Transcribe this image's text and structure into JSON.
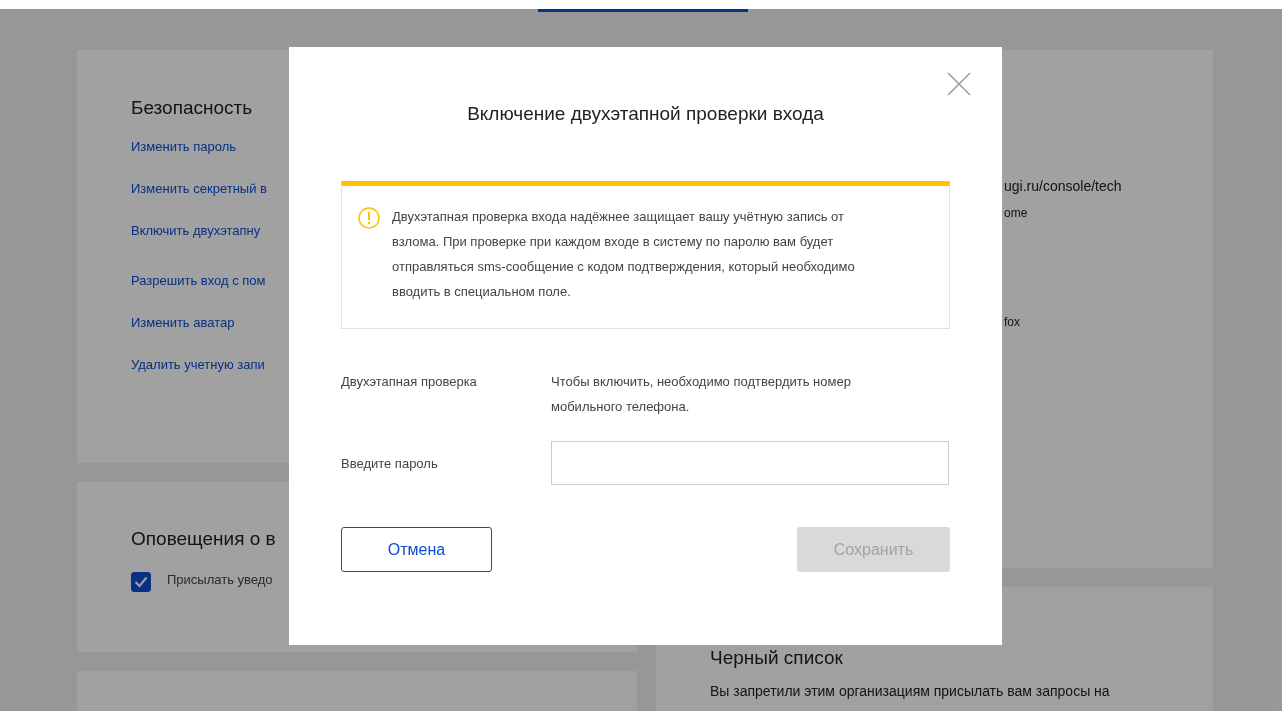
{
  "background": {
    "security": {
      "title": "Безопасность",
      "links": [
        "Изменить пароль",
        "Изменить секретный в",
        "Включить двухэтапну",
        "Разрешить вход с пом",
        "Изменить аватар",
        "Удалить учетную запи"
      ]
    },
    "notifications": {
      "title": "Оповещения о в",
      "options": [
        {
          "label": "Присылать уведо",
          "checked": true
        }
      ]
    },
    "sessions": {
      "lines": [
        {
          "kind": "big",
          "text": "ugi.ru/console/tech"
        },
        {
          "kind": "small",
          "text": "ome"
        },
        {
          "kind": "small",
          "text": "fox"
        }
      ]
    },
    "blacklist": {
      "title": "Черный список",
      "text": "Вы запретили этим организациям присылать вам запросы на"
    }
  },
  "modal": {
    "title": "Включение двухэтапной проверки входа",
    "notice": "Двухэтапная проверка входа надёжнее защищает вашу учётную запись от взлома. При проверке при каждом входе в систему по паролю вам будет отправляться sms-сообщение с кодом подтверждения, который необходимо вводить в специальном поле.",
    "rows": [
      {
        "kind": "text",
        "label": "Двухэтапная проверка",
        "value": "Чтобы включить, необходимо подтвердить номер мобильного телефона."
      },
      {
        "kind": "input",
        "label": "Введите пароль"
      }
    ],
    "buttons": [
      {
        "kind": "secondary",
        "label": "Отмена",
        "disabled": false
      },
      {
        "kind": "primary",
        "label": "Сохранить",
        "disabled": true
      }
    ]
  }
}
